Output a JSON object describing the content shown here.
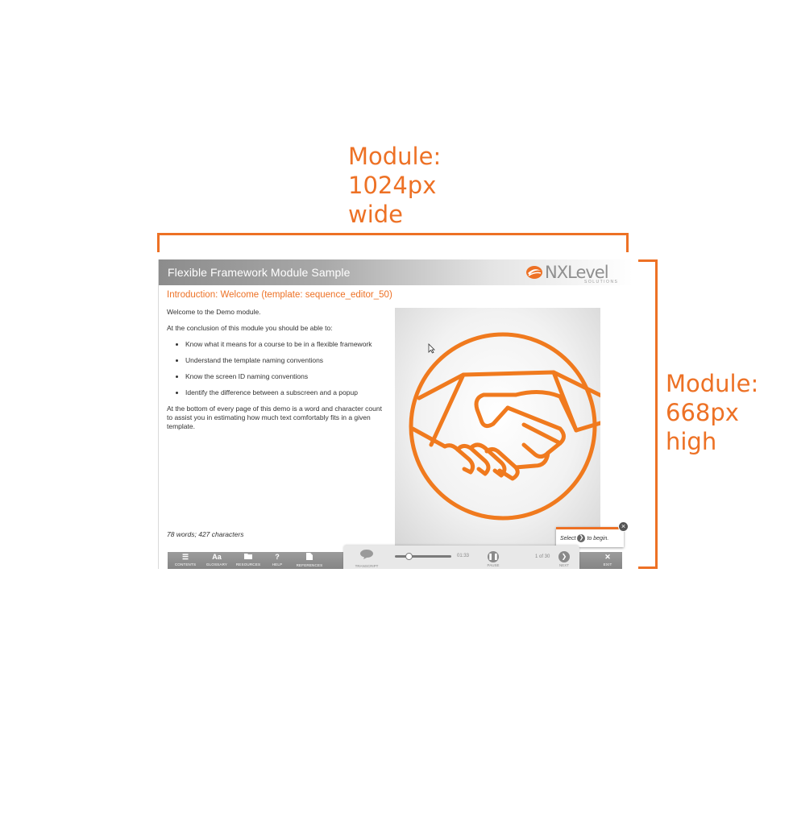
{
  "annotations": {
    "width_label": [
      "Module:",
      "1024px",
      "wide"
    ],
    "height_label": [
      "Module:",
      "668px",
      "high"
    ],
    "accent_color": "#ed7125"
  },
  "module": {
    "title": "Flexible Framework Module Sample",
    "logo": {
      "nx": "NX",
      "level": "Level",
      "sub": "SOLUTIONS"
    },
    "heading": "Introduction: Welcome (template: sequence_editor_50)",
    "intro": "Welcome to the Demo module.",
    "conclusion_lead": "At the conclusion of this module you should be able to:",
    "bullets": [
      "Know what it means for a course to be in a flexible framework",
      "Understand the template naming conventions",
      "Know the screen ID naming conventions",
      "Identify the difference between a subscreen and a popup"
    ],
    "footer_note": "At the bottom of every page of this demo is a word and character count to assist you in estimating how much text comfortably fits in a given template.",
    "word_count": "78 words; 427 characters",
    "image_icon": "handshake-icon",
    "popup": {
      "before": "Select",
      "after": "to begin."
    }
  },
  "nav": {
    "contents": "CONTENTS",
    "glossary": "GLOSSARY",
    "glossary_icon": "Aa",
    "resources": "RESOURCES",
    "help": "HELP",
    "help_icon": "?",
    "references": "REFERENCES",
    "transcript": "TRANSCRIPT",
    "time": "01:33",
    "pause": "PAUSE",
    "page_count": "1 of 30",
    "next": "NEXT",
    "exit": "EXIT"
  }
}
